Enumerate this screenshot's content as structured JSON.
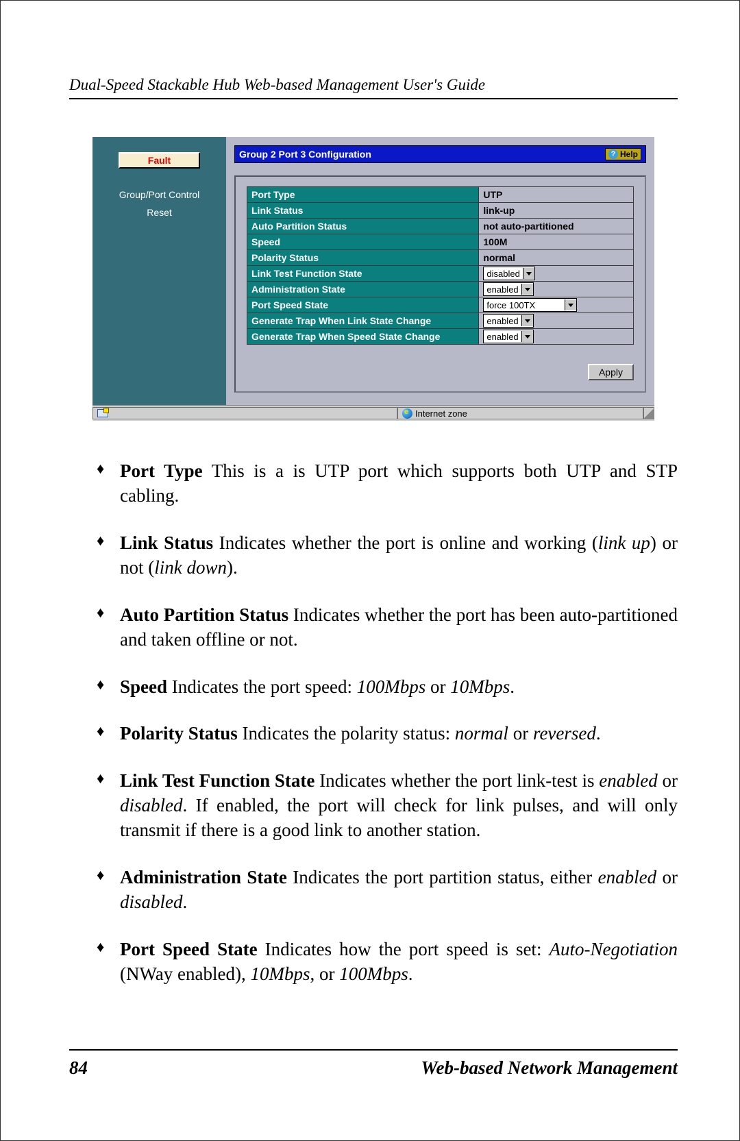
{
  "header": {
    "running": "Dual-Speed Stackable Hub Web-based Management User's Guide"
  },
  "footer": {
    "page": "84",
    "chapter": "Web-based Network Management"
  },
  "app": {
    "sidebar": {
      "fault": "Fault",
      "items": [
        "Group/Port Control",
        "Reset"
      ]
    },
    "titlebar": {
      "title": "Group 2 Port 3 Configuration",
      "help": "Help"
    },
    "rows": [
      {
        "label": "Port Type",
        "value": "UTP",
        "kind": "text"
      },
      {
        "label": "Link Status",
        "value": "link-up",
        "kind": "text"
      },
      {
        "label": "Auto Partition Status",
        "value": "not auto-partitioned",
        "kind": "text"
      },
      {
        "label": "Speed",
        "value": "100M",
        "kind": "text"
      },
      {
        "label": "Polarity Status",
        "value": "normal",
        "kind": "text"
      },
      {
        "label": "Link Test Function State",
        "value": "disabled",
        "kind": "select"
      },
      {
        "label": "Administration State",
        "value": "enabled",
        "kind": "select"
      },
      {
        "label": "Port Speed State",
        "value": "force 100TX",
        "kind": "select-wide"
      },
      {
        "label": "Generate Trap When Link State Change",
        "value": "enabled",
        "kind": "select"
      },
      {
        "label": "Generate Trap When Speed State Change",
        "value": "enabled",
        "kind": "select"
      }
    ],
    "apply": "Apply",
    "status": {
      "zone": "Internet zone"
    }
  },
  "bullets": [
    {
      "term": "Port Type",
      "gap": "    ",
      "segs": [
        "This is a is UTP port which supports both UTP and STP cabling."
      ]
    },
    {
      "term": "Link Status",
      "gap": "    ",
      "segs": [
        "Indicates whether the port is online and working (",
        {
          "it": "link up"
        },
        ") or not (",
        {
          "it": "link down"
        },
        ")."
      ]
    },
    {
      "term": "Auto  Partition  Status",
      "gap": "       ",
      "segs": [
        "Indicates  whether  the  port  has  been auto-partitioned and taken offline or not."
      ]
    },
    {
      "term": "Speed",
      "gap": "    ",
      "segs": [
        "Indicates the port speed:  ",
        {
          "it": "100Mbps"
        },
        " or ",
        {
          "it": "10Mbps"
        },
        "."
      ]
    },
    {
      "term": "Polarity Status",
      "gap": "    ",
      "segs": [
        "Indicates the polarity status:  ",
        {
          "it": "normal"
        },
        " or ",
        {
          "it": "reversed"
        },
        "."
      ]
    },
    {
      "term": "Link Test Function State",
      "gap": "    ",
      "segs": [
        "Indicates whether the port link-test is ",
        {
          "it": "enabled"
        },
        " or ",
        {
          "it": "disabled"
        },
        ".  If enabled, the port will check for link pulses, and will only transmit if there is a good link to another station."
      ]
    },
    {
      "term": "Administration State",
      "gap": "     ",
      "segs": [
        "Indicates the port    partition status, either ",
        {
          "it": "enabled"
        },
        " or ",
        {
          "it": "disabled"
        },
        "."
      ]
    },
    {
      "term": "Port  Speed  State",
      "gap": "      ",
      "segs": [
        "Indicates  how  the  port  speed  is  set:   ",
        {
          "it": "Auto-Negotiation"
        },
        " (NWay enabled), ",
        {
          "it": "10Mbps"
        },
        ", or ",
        {
          "it": "100Mbps"
        },
        "."
      ]
    }
  ]
}
